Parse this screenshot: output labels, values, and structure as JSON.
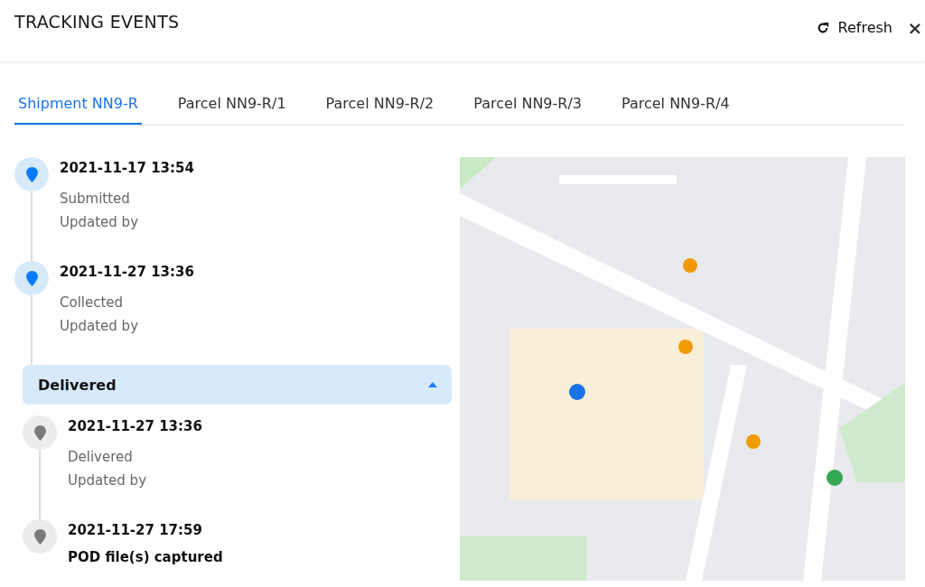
{
  "window": {
    "title": "TRACKING EVENTS",
    "refresh": "Refresh",
    "close": "×"
  },
  "tabs": [
    {
      "label": "Shipment NN9-R",
      "selected": true
    },
    {
      "label": "Parcel NN9-R/1",
      "selected": false
    },
    {
      "label": "Parcel NN9-R/2",
      "selected": false
    },
    {
      "label": "Parcel NN9-R/3",
      "selected": false
    },
    {
      "label": "Parcel NN9-R/4",
      "selected": false
    }
  ],
  "events": [
    {
      "time": "2021-11-17 13:54",
      "status": "Submitted",
      "updated_by": "Updated by"
    },
    {
      "time": "2021-11-27 13:36",
      "status": "Collected",
      "updated_by": "Updated by"
    }
  ],
  "groups": [
    {
      "label": "Delivered",
      "expanded": true,
      "children": [
        {
          "time": "2021-11-27 13:36",
          "status": "Delivered",
          "updated_by": "Updated by"
        },
        {
          "time": "2021-11-27 17:59",
          "note": "POD file(s) captured"
        }
      ]
    }
  ]
}
